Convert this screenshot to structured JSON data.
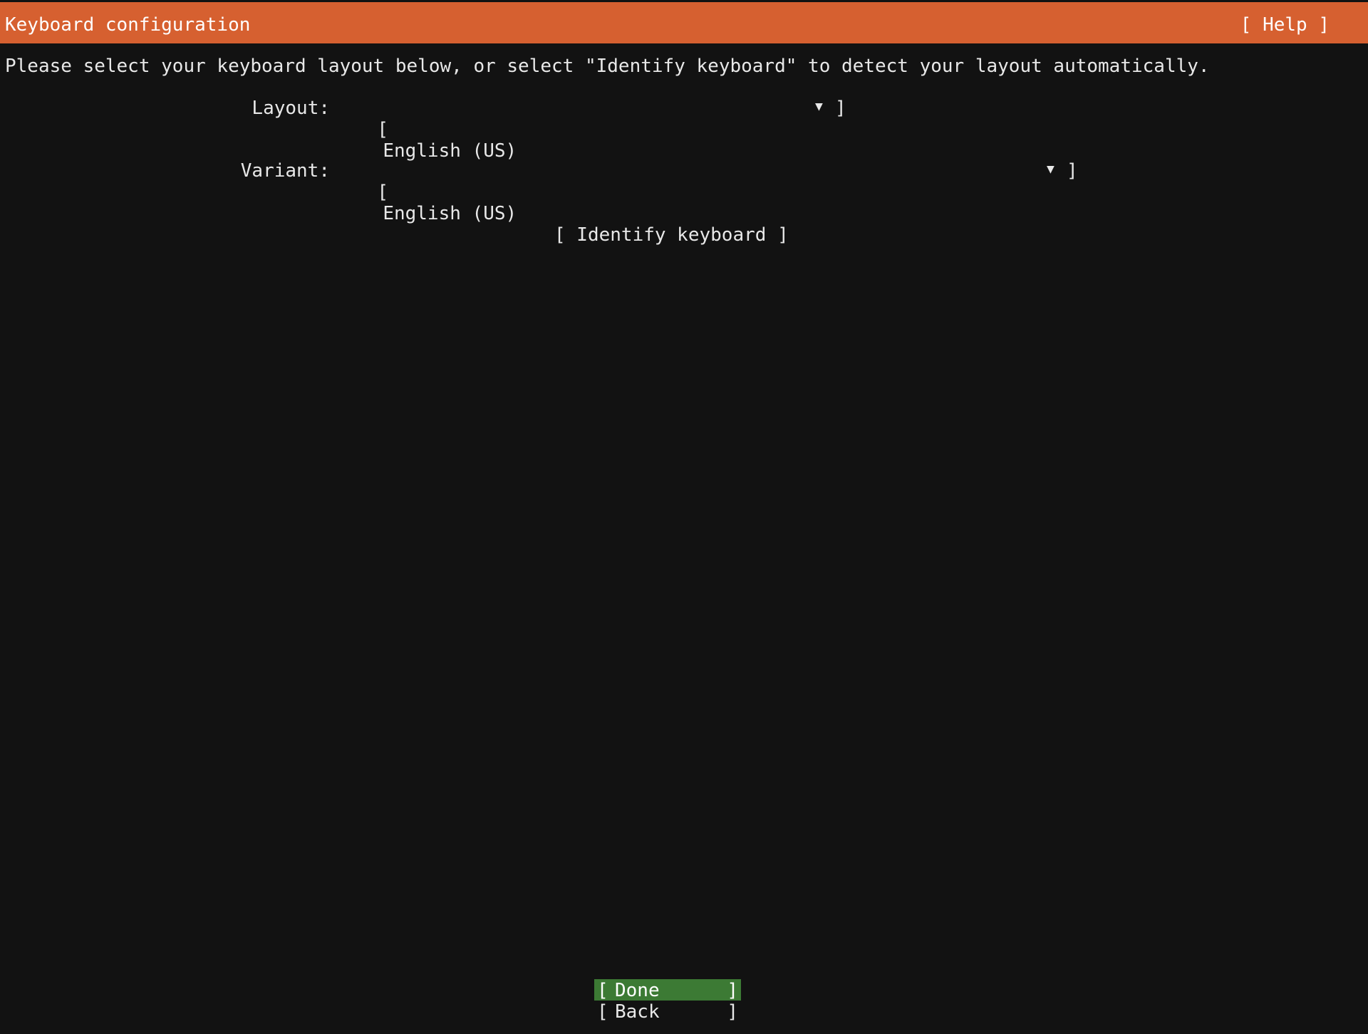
{
  "header": {
    "title": "Keyboard configuration",
    "help_label": "[ Help ]"
  },
  "instructions": "Please select your keyboard layout below, or select \"Identify keyboard\" to detect your layout automatically.",
  "layout": {
    "label": "Layout:",
    "open": "[",
    "value": "English (US)",
    "arrow_icon": "triangle-down-icon",
    "arrow": "▼",
    "close": "]"
  },
  "variant": {
    "label": "Variant:",
    "open": "[",
    "value": "English (US)",
    "arrow_icon": "triangle-down-icon",
    "arrow": "▼",
    "close": "]"
  },
  "identify_button": "[ Identify keyboard ]",
  "buttons": {
    "open": "[",
    "close": "]",
    "done_label": "Done",
    "back_label": "Back"
  },
  "colors": {
    "header_bg": "#d66030",
    "background": "#121212",
    "done_bg": "#3c7a34"
  }
}
